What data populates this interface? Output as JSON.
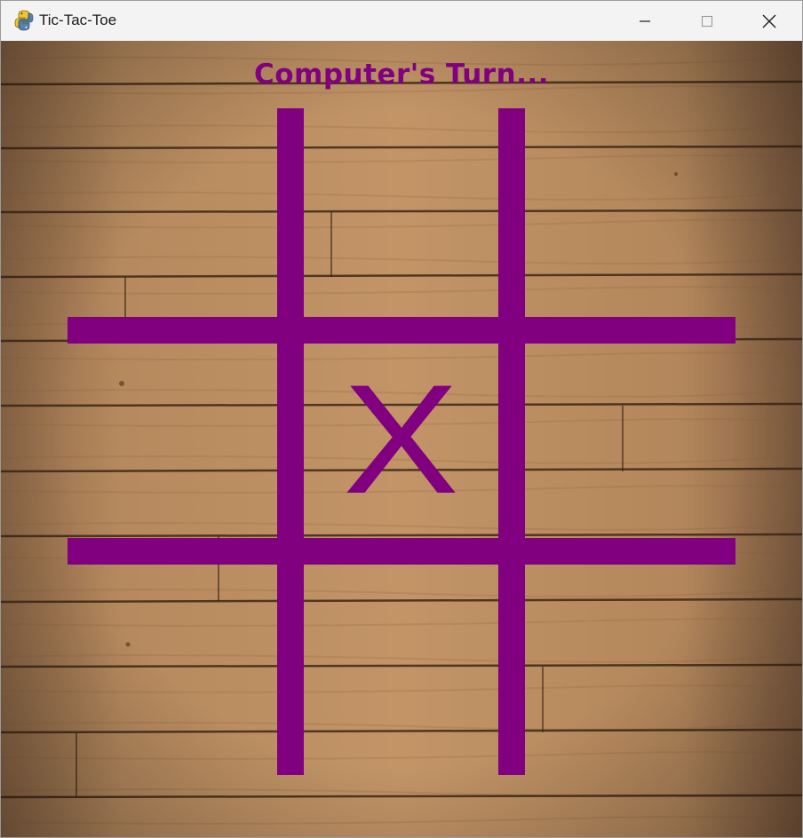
{
  "window": {
    "title": "Tic-Tac-Toe",
    "app_icon": "python-snake-icon",
    "controls": [
      "minimize-icon",
      "maximize-icon",
      "close-icon"
    ]
  },
  "game": {
    "status": "Computer's Turn...",
    "accent_color": "#800080",
    "background": "wood-planks",
    "board": [
      [
        "",
        "",
        ""
      ],
      [
        "",
        "X",
        ""
      ],
      [
        "",
        "",
        ""
      ]
    ]
  }
}
